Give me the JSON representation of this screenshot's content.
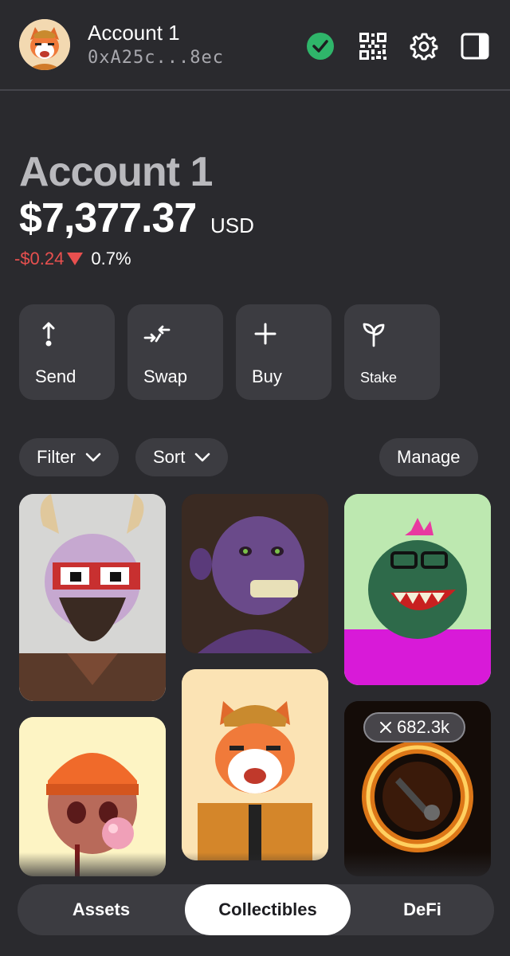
{
  "header": {
    "account_name": "Account 1",
    "address": "0xA25c...8ec",
    "icons": [
      "check-circle-icon",
      "qr-code-icon",
      "gear-icon",
      "side-panel-icon"
    ]
  },
  "balance": {
    "account_name": "Account 1",
    "amount": "$7,377.37",
    "currency": "USD",
    "change_amount": "-$0.24",
    "change_percent": "0.7%"
  },
  "actions": [
    {
      "label": "Send",
      "icon": "send-icon"
    },
    {
      "label": "Swap",
      "icon": "swap-icon"
    },
    {
      "label": "Buy",
      "icon": "plus-icon"
    },
    {
      "label": "Stake",
      "icon": "sprout-icon"
    }
  ],
  "controls": {
    "filter_label": "Filter",
    "sort_label": "Sort",
    "manage_label": "Manage"
  },
  "collectibles": {
    "badge_value": "682.3k"
  },
  "tabs": [
    {
      "label": "Assets"
    },
    {
      "label": "Collectibles",
      "active": true
    },
    {
      "label": "DeFi"
    }
  ],
  "colors": {
    "background": "#2a2a2e",
    "surface": "#3c3c41",
    "negative": "#e8504f",
    "success": "#2fb56a"
  }
}
